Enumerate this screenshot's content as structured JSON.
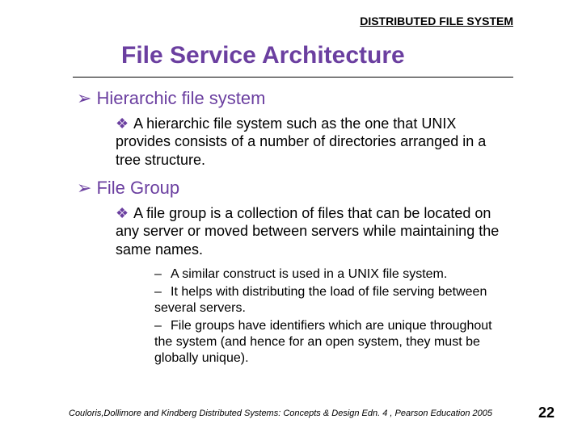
{
  "header": "DISTRIBUTED FILE SYSTEM",
  "title": "File Service Architecture",
  "bullets": {
    "b1": {
      "heading": "Hierarchic file system",
      "p1": "A hierarchic file system such as the one that UNIX provides consists of a number of directories arranged in a tree structure."
    },
    "b2": {
      "heading": "File Group",
      "p1": "A file group is a collection of files that can be located on any server or moved between servers while maintaining the same names.",
      "s1": "A similar construct is used in a UNIX file system.",
      "s2": "It helps with distributing the load of file serving between several servers.",
      "s3": "File groups have identifiers which are unique throughout the system (and hence for an open system, they must be globally unique)."
    }
  },
  "footer": {
    "credit": "Couloris,Dollimore and Kindberg  Distributed Systems: Concepts & Design  Edn. 4 , Pearson Education 2005",
    "page": "22"
  },
  "glyphs": {
    "arrow": "➢",
    "diamond": "❖",
    "dash": "–"
  }
}
